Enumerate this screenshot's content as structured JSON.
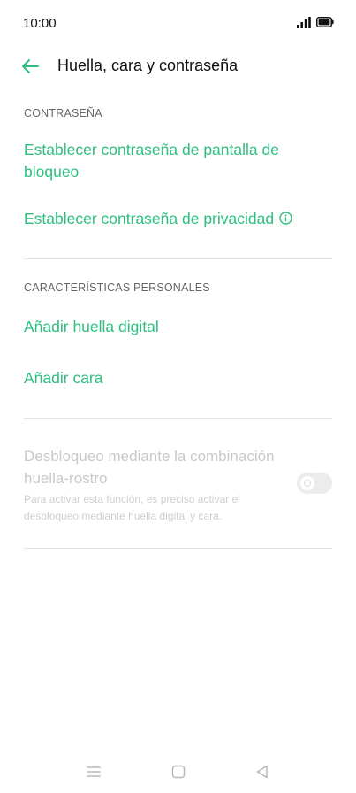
{
  "status_bar": {
    "time": "10:00",
    "signal_icon": "signal-icon",
    "battery_icon": "battery-icon"
  },
  "header": {
    "back_icon": "back-arrow-icon",
    "title": "Huella, cara y contraseña"
  },
  "password_section": {
    "header": "CONTRASEÑA",
    "items": [
      {
        "label": "Establecer contraseña de pantalla de bloqueo"
      },
      {
        "label": "Establecer contraseña de privacidad",
        "icon": "info-icon"
      }
    ]
  },
  "personal_section": {
    "header": "CARACTERÍSTICAS PERSONALES",
    "items": [
      {
        "label": "Añadir huella digital"
      },
      {
        "label": "Añadir cara"
      }
    ]
  },
  "combo_unlock": {
    "title": "Desbloqueo mediante la combinación huella-rostro",
    "description": "Para activar esta función, es preciso activar el desbloqueo mediante huella digital y cara.",
    "enabled": false,
    "toggle_on": false
  },
  "navigation_bar": {
    "buttons": [
      "menu-icon",
      "home-icon",
      "back-icon"
    ]
  },
  "colors": {
    "accent": "#2ebf80",
    "disabled_text": "#c9c9c9",
    "section_header": "#666666",
    "divider": "#e3e3e3"
  }
}
